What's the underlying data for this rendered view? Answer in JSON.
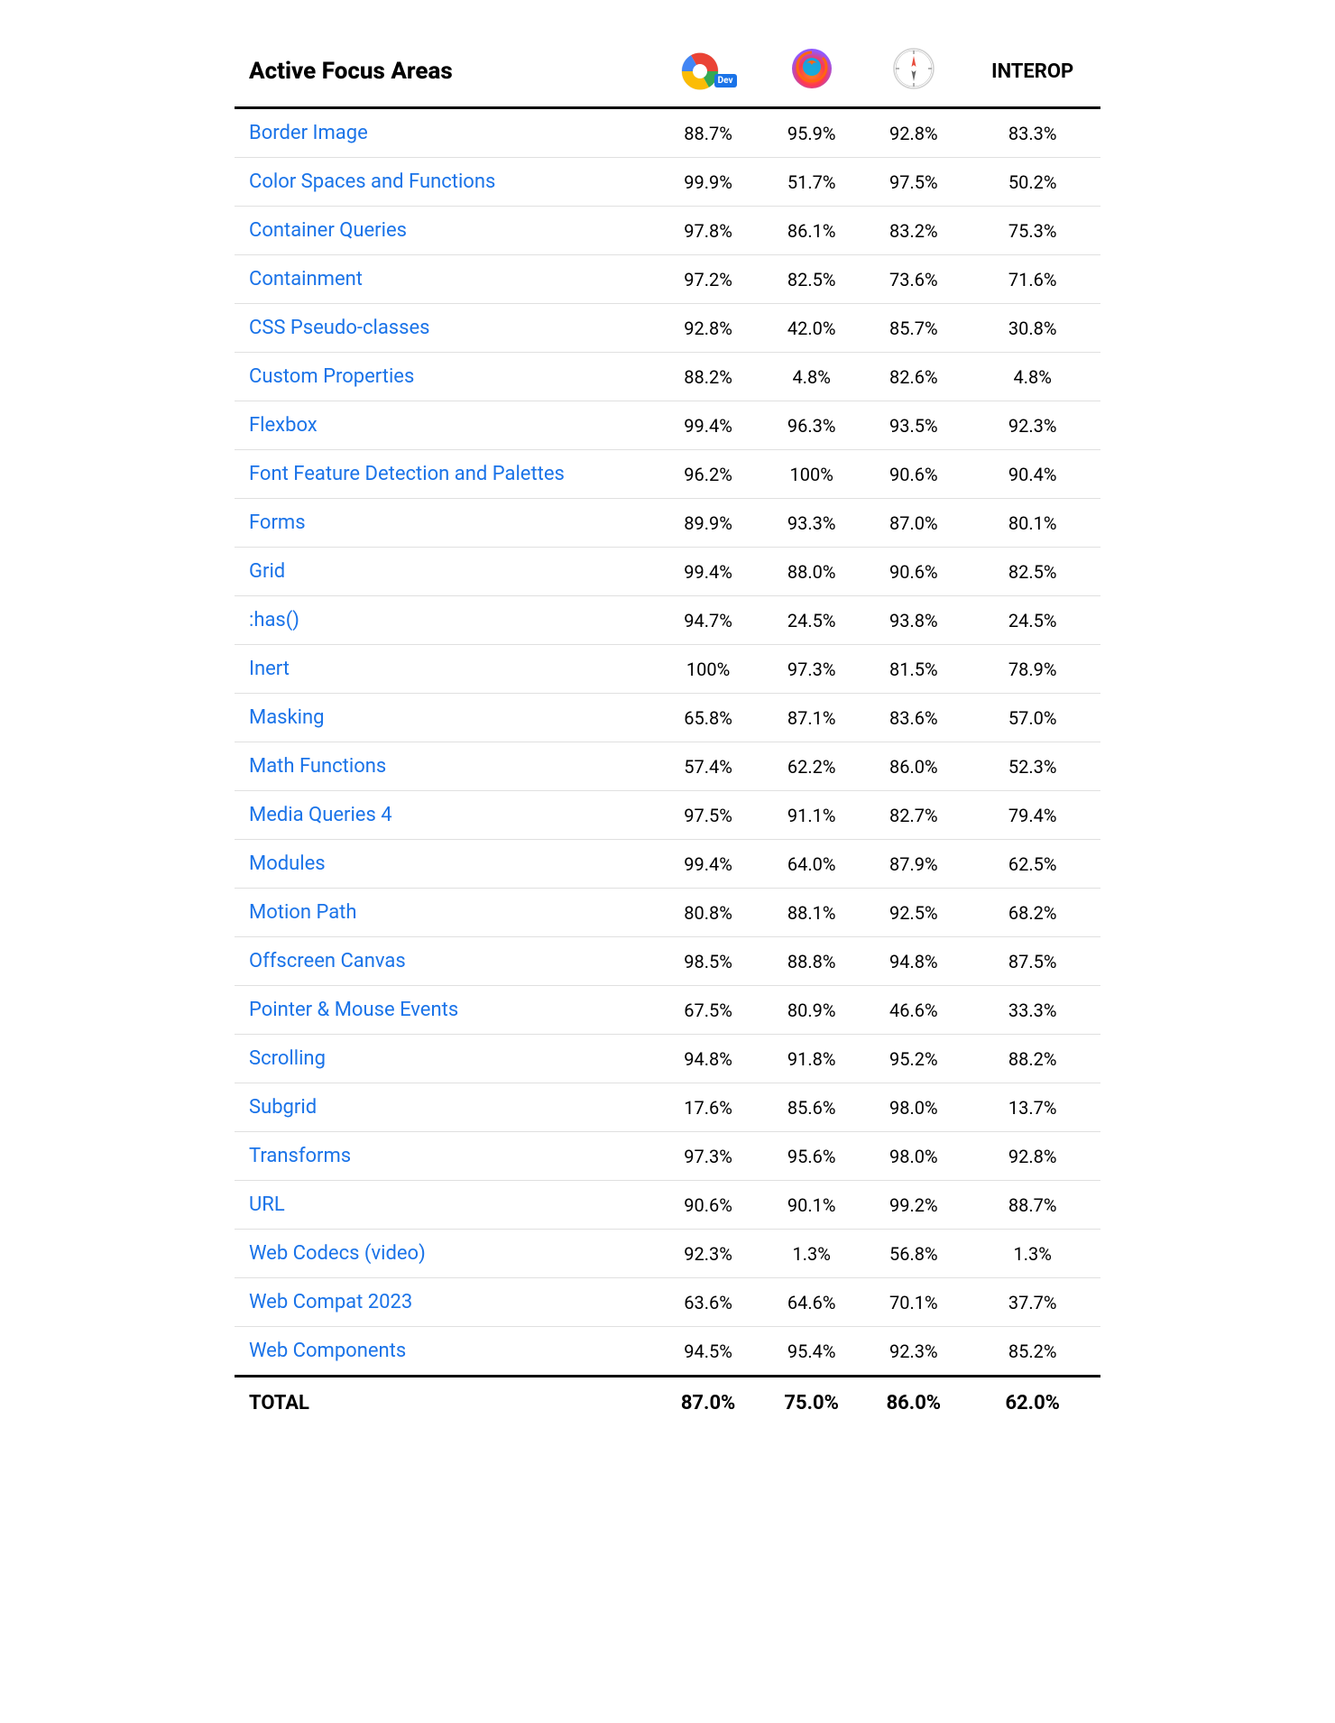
{
  "table": {
    "header": {
      "col1": "Active Focus Areas",
      "col2_label": "Chrome Dev",
      "col3_label": "Firefox",
      "col4_label": "Safari",
      "col5": "INTEROP"
    },
    "rows": [
      {
        "name": "Border Image",
        "col2": "88.7%",
        "col3": "95.9%",
        "col4": "92.8%",
        "col5": "83.3%"
      },
      {
        "name": "Color Spaces and Functions",
        "col2": "99.9%",
        "col3": "51.7%",
        "col4": "97.5%",
        "col5": "50.2%"
      },
      {
        "name": "Container Queries",
        "col2": "97.8%",
        "col3": "86.1%",
        "col4": "83.2%",
        "col5": "75.3%"
      },
      {
        "name": "Containment",
        "col2": "97.2%",
        "col3": "82.5%",
        "col4": "73.6%",
        "col5": "71.6%"
      },
      {
        "name": "CSS Pseudo-classes",
        "col2": "92.8%",
        "col3": "42.0%",
        "col4": "85.7%",
        "col5": "30.8%"
      },
      {
        "name": "Custom Properties",
        "col2": "88.2%",
        "col3": "4.8%",
        "col4": "82.6%",
        "col5": "4.8%"
      },
      {
        "name": "Flexbox",
        "col2": "99.4%",
        "col3": "96.3%",
        "col4": "93.5%",
        "col5": "92.3%"
      },
      {
        "name": "Font Feature Detection and Palettes",
        "col2": "96.2%",
        "col3": "100%",
        "col4": "90.6%",
        "col5": "90.4%"
      },
      {
        "name": "Forms",
        "col2": "89.9%",
        "col3": "93.3%",
        "col4": "87.0%",
        "col5": "80.1%"
      },
      {
        "name": "Grid",
        "col2": "99.4%",
        "col3": "88.0%",
        "col4": "90.6%",
        "col5": "82.5%"
      },
      {
        "name": ":has()",
        "col2": "94.7%",
        "col3": "24.5%",
        "col4": "93.8%",
        "col5": "24.5%"
      },
      {
        "name": "Inert",
        "col2": "100%",
        "col3": "97.3%",
        "col4": "81.5%",
        "col5": "78.9%"
      },
      {
        "name": "Masking",
        "col2": "65.8%",
        "col3": "87.1%",
        "col4": "83.6%",
        "col5": "57.0%"
      },
      {
        "name": "Math Functions",
        "col2": "57.4%",
        "col3": "62.2%",
        "col4": "86.0%",
        "col5": "52.3%"
      },
      {
        "name": "Media Queries 4",
        "col2": "97.5%",
        "col3": "91.1%",
        "col4": "82.7%",
        "col5": "79.4%"
      },
      {
        "name": "Modules",
        "col2": "99.4%",
        "col3": "64.0%",
        "col4": "87.9%",
        "col5": "62.5%"
      },
      {
        "name": "Motion Path",
        "col2": "80.8%",
        "col3": "88.1%",
        "col4": "92.5%",
        "col5": "68.2%"
      },
      {
        "name": "Offscreen Canvas",
        "col2": "98.5%",
        "col3": "88.8%",
        "col4": "94.8%",
        "col5": "87.5%"
      },
      {
        "name": "Pointer & Mouse Events",
        "col2": "67.5%",
        "col3": "80.9%",
        "col4": "46.6%",
        "col5": "33.3%"
      },
      {
        "name": "Scrolling",
        "col2": "94.8%",
        "col3": "91.8%",
        "col4": "95.2%",
        "col5": "88.2%"
      },
      {
        "name": "Subgrid",
        "col2": "17.6%",
        "col3": "85.6%",
        "col4": "98.0%",
        "col5": "13.7%"
      },
      {
        "name": "Transforms",
        "col2": "97.3%",
        "col3": "95.6%",
        "col4": "98.0%",
        "col5": "92.8%"
      },
      {
        "name": "URL",
        "col2": "90.6%",
        "col3": "90.1%",
        "col4": "99.2%",
        "col5": "88.7%"
      },
      {
        "name": "Web Codecs (video)",
        "col2": "92.3%",
        "col3": "1.3%",
        "col4": "56.8%",
        "col5": "1.3%"
      },
      {
        "name": "Web Compat 2023",
        "col2": "63.6%",
        "col3": "64.6%",
        "col4": "70.1%",
        "col5": "37.7%"
      },
      {
        "name": "Web Components",
        "col2": "94.5%",
        "col3": "95.4%",
        "col4": "92.3%",
        "col5": "85.2%"
      }
    ],
    "footer": {
      "label": "TOTAL",
      "col2": "87.0%",
      "col3": "75.0%",
      "col4": "86.0%",
      "col5": "62.0%"
    }
  }
}
